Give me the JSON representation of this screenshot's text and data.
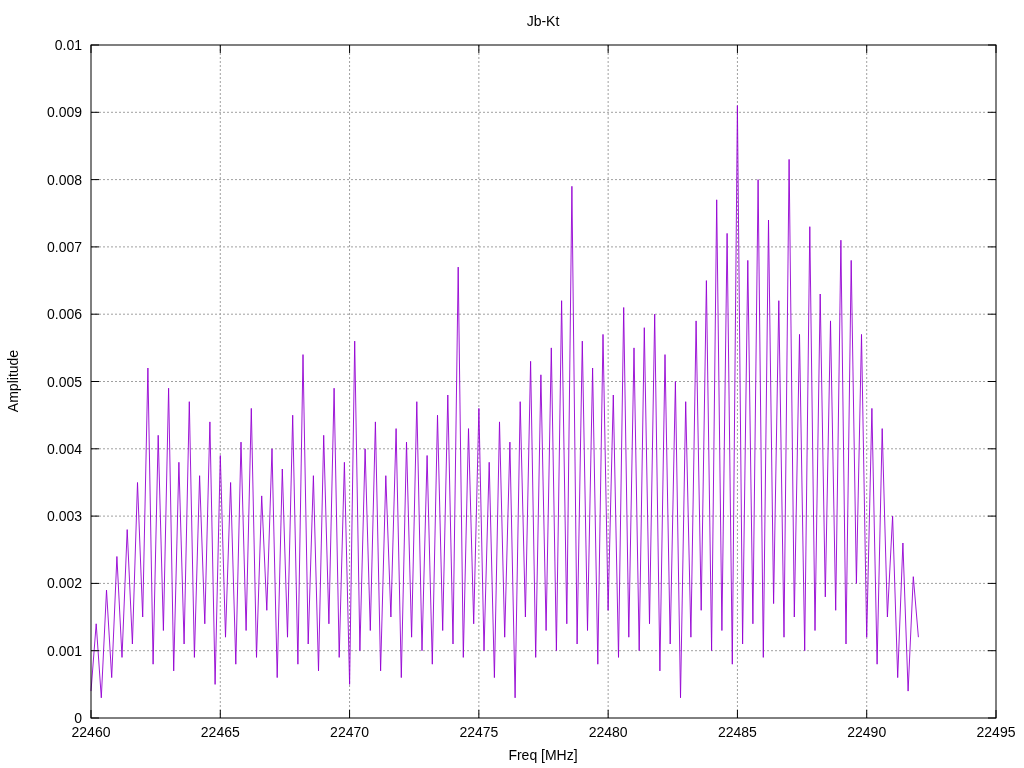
{
  "chart": {
    "chart_data": {
      "type": "line",
      "grid": true,
      "title": "Jb-Kt",
      "xlabel": "Freq [MHz]",
      "ylabel": "Amplitude",
      "xlim": [
        22460,
        22495
      ],
      "ylim": [
        0,
        0.01
      ],
      "xticks": [
        22460,
        22465,
        22470,
        22475,
        22480,
        22485,
        22490,
        22495
      ],
      "yticks": [
        0.01,
        0.009,
        0.008,
        0.007,
        0.006,
        0.005,
        0.004,
        0.003,
        0.002,
        0.001,
        0
      ],
      "x": [
        22460,
        22460.2,
        22460.4,
        22460.6,
        22460.8,
        22461,
        22461.2,
        22461.4,
        22461.6,
        22461.8,
        22462,
        22462.2,
        22462.4,
        22462.6,
        22462.8,
        22463,
        22463.2,
        22463.4,
        22463.6,
        22463.8,
        22464,
        22464.2,
        22464.4,
        22464.6,
        22464.8,
        22465,
        22465.2,
        22465.4,
        22465.6,
        22465.8,
        22466,
        22466.2,
        22466.4,
        22466.6,
        22466.8,
        22467,
        22467.2,
        22467.4,
        22467.6,
        22467.8,
        22468,
        22468.2,
        22468.4,
        22468.6,
        22468.8,
        22469,
        22469.2,
        22469.4,
        22469.6,
        22469.8,
        22470,
        22470.2,
        22470.4,
        22470.6,
        22470.8,
        22471,
        22471.2,
        22471.4,
        22471.6,
        22471.8,
        22472,
        22472.2,
        22472.4,
        22472.6,
        22472.8,
        22473,
        22473.2,
        22473.4,
        22473.6,
        22473.8,
        22474,
        22474.2,
        22474.4,
        22474.6,
        22474.8,
        22475,
        22475.2,
        22475.4,
        22475.6,
        22475.8,
        22476,
        22476.2,
        22476.4,
        22476.6,
        22476.8,
        22477,
        22477.2,
        22477.4,
        22477.6,
        22477.8,
        22478,
        22478.2,
        22478.4,
        22478.6,
        22478.8,
        22479,
        22479.2,
        22479.4,
        22479.6,
        22479.8,
        22480,
        22480.2,
        22480.4,
        22480.6,
        22480.8,
        22481,
        22481.2,
        22481.4,
        22481.6,
        22481.8,
        22482,
        22482.2,
        22482.4,
        22482.6,
        22482.8,
        22483,
        22483.2,
        22483.4,
        22483.6,
        22483.8,
        22484,
        22484.2,
        22484.4,
        22484.6,
        22484.8,
        22485,
        22485.2,
        22485.4,
        22485.6,
        22485.8,
        22486,
        22486.2,
        22486.4,
        22486.6,
        22486.8,
        22487,
        22487.2,
        22487.4,
        22487.6,
        22487.8,
        22488,
        22488.2,
        22488.4,
        22488.6,
        22488.8,
        22489,
        22489.2,
        22489.4,
        22489.6,
        22489.8,
        22490,
        22490.2,
        22490.4,
        22490.6,
        22490.8,
        22491,
        22491.2,
        22491.4,
        22491.6,
        22491.8,
        22492
      ],
      "series": [
        {
          "color": "#9400d3",
          "values": [
            0.0004,
            0.0014,
            0.0003,
            0.0019,
            0.0006,
            0.0024,
            0.0009,
            0.0028,
            0.0011,
            0.0035,
            0.0015,
            0.0052,
            0.0008,
            0.0042,
            0.0013,
            0.0049,
            0.0007,
            0.0038,
            0.0011,
            0.0047,
            0.0009,
            0.0036,
            0.0014,
            0.0044,
            0.0005,
            0.0039,
            0.0012,
            0.0035,
            0.0008,
            0.0041,
            0.0013,
            0.0046,
            0.0009,
            0.0033,
            0.0016,
            0.004,
            0.0006,
            0.0037,
            0.0012,
            0.0045,
            0.0008,
            0.0054,
            0.0011,
            0.0036,
            0.0007,
            0.0042,
            0.0014,
            0.0049,
            0.0009,
            0.0038,
            0.0005,
            0.0056,
            0.001,
            0.004,
            0.0013,
            0.0044,
            0.0007,
            0.0036,
            0.0015,
            0.0043,
            0.0006,
            0.0041,
            0.0012,
            0.0047,
            0.001,
            0.0039,
            0.0008,
            0.0045,
            0.0013,
            0.0048,
            0.0011,
            0.0067,
            0.0009,
            0.0043,
            0.0014,
            0.0046,
            0.001,
            0.0038,
            0.0006,
            0.0044,
            0.0012,
            0.0041,
            0.0003,
            0.0047,
            0.0015,
            0.0053,
            0.0009,
            0.0051,
            0.0013,
            0.0055,
            0.001,
            0.0062,
            0.0014,
            0.0079,
            0.0011,
            0.0056,
            0.0013,
            0.0052,
            0.0008,
            0.0057,
            0.0016,
            0.0048,
            0.0009,
            0.0061,
            0.0012,
            0.0055,
            0.001,
            0.0058,
            0.0014,
            0.006,
            0.0007,
            0.0054,
            0.0011,
            0.005,
            0.0003,
            0.0047,
            0.0012,
            0.0059,
            0.0016,
            0.0065,
            0.001,
            0.0077,
            0.0013,
            0.0072,
            0.0008,
            0.0091,
            0.0011,
            0.0068,
            0.0014,
            0.008,
            0.0009,
            0.0074,
            0.0017,
            0.0062,
            0.0012,
            0.0083,
            0.0015,
            0.0057,
            0.001,
            0.0073,
            0.0013,
            0.0063,
            0.0018,
            0.0059,
            0.0016,
            0.0071,
            0.0011,
            0.0068,
            0.002,
            0.0057,
            0.0012,
            0.0046,
            0.0008,
            0.0043,
            0.0015,
            0.003,
            0.0006,
            0.0026,
            0.0004,
            0.0021,
            0.0012
          ]
        }
      ]
    }
  }
}
